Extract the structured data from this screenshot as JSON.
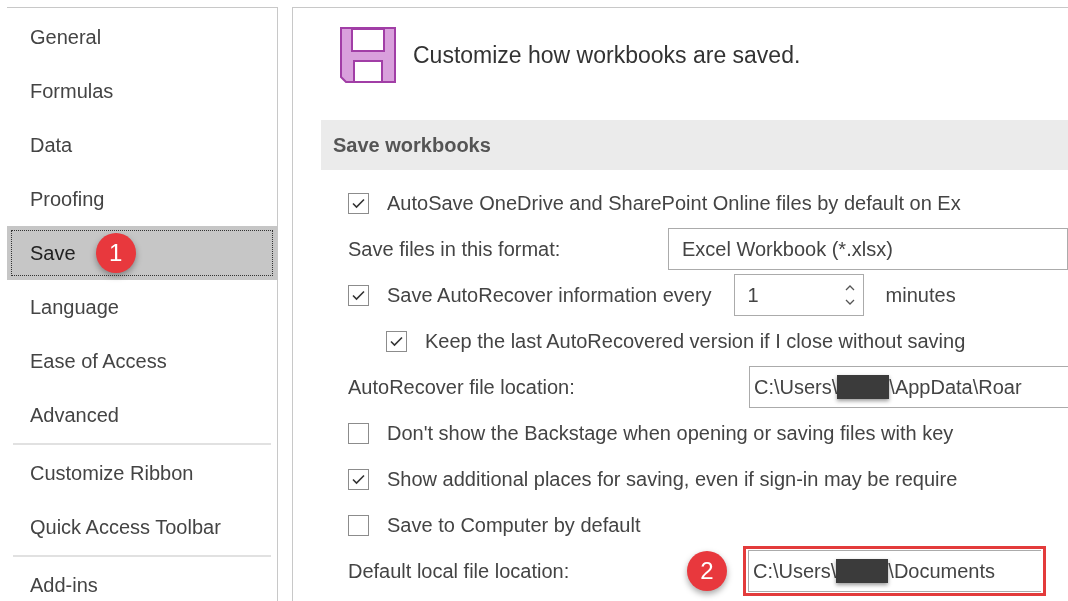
{
  "sidebar": {
    "groups": [
      [
        {
          "label": "General",
          "selected": false
        },
        {
          "label": "Formulas",
          "selected": false
        },
        {
          "label": "Data",
          "selected": false
        },
        {
          "label": "Proofing",
          "selected": false
        },
        {
          "label": "Save",
          "selected": true,
          "marker": "1"
        },
        {
          "label": "Language",
          "selected": false
        },
        {
          "label": "Ease of Access",
          "selected": false
        },
        {
          "label": "Advanced",
          "selected": false
        }
      ],
      [
        {
          "label": "Customize Ribbon",
          "selected": false
        },
        {
          "label": "Quick Access Toolbar",
          "selected": false
        }
      ],
      [
        {
          "label": "Add-ins",
          "selected": false
        }
      ]
    ]
  },
  "main": {
    "heading": "Customize how workbooks are saved.",
    "section": "Save workbooks",
    "rows": [
      {
        "kind": "checkbox",
        "label": "AutoSave OneDrive and SharePoint Online files by default on Ex",
        "checked": true
      },
      {
        "kind": "dropdown",
        "label": "Save files in this format:",
        "value": "Excel Workbook (*.xlsx)"
      },
      {
        "kind": "spin",
        "label": "Save AutoRecover information every",
        "checked": true,
        "value": "1",
        "unit": "minutes",
        "children": [
          {
            "kind": "checkbox",
            "label": "Keep the last AutoRecovered version if I close without saving",
            "checked": true
          }
        ]
      },
      {
        "kind": "path",
        "label": "AutoRecover file location:",
        "prefix": "C:\\Users\\",
        "suffix": "\\AppData\\Roar"
      },
      {
        "kind": "checkbox",
        "label": "Don't show the Backstage when opening or saving files with key",
        "checked": false
      },
      {
        "kind": "checkbox",
        "label": "Show additional places for saving, even if sign-in may be require",
        "checked": true
      },
      {
        "kind": "checkbox",
        "label": "Save to Computer by default",
        "checked": false
      },
      {
        "kind": "path",
        "label": "Default local file location:",
        "prefix": "C:\\Users\\",
        "suffix": "\\Documents",
        "marker": "2",
        "highlighted": true
      }
    ]
  }
}
